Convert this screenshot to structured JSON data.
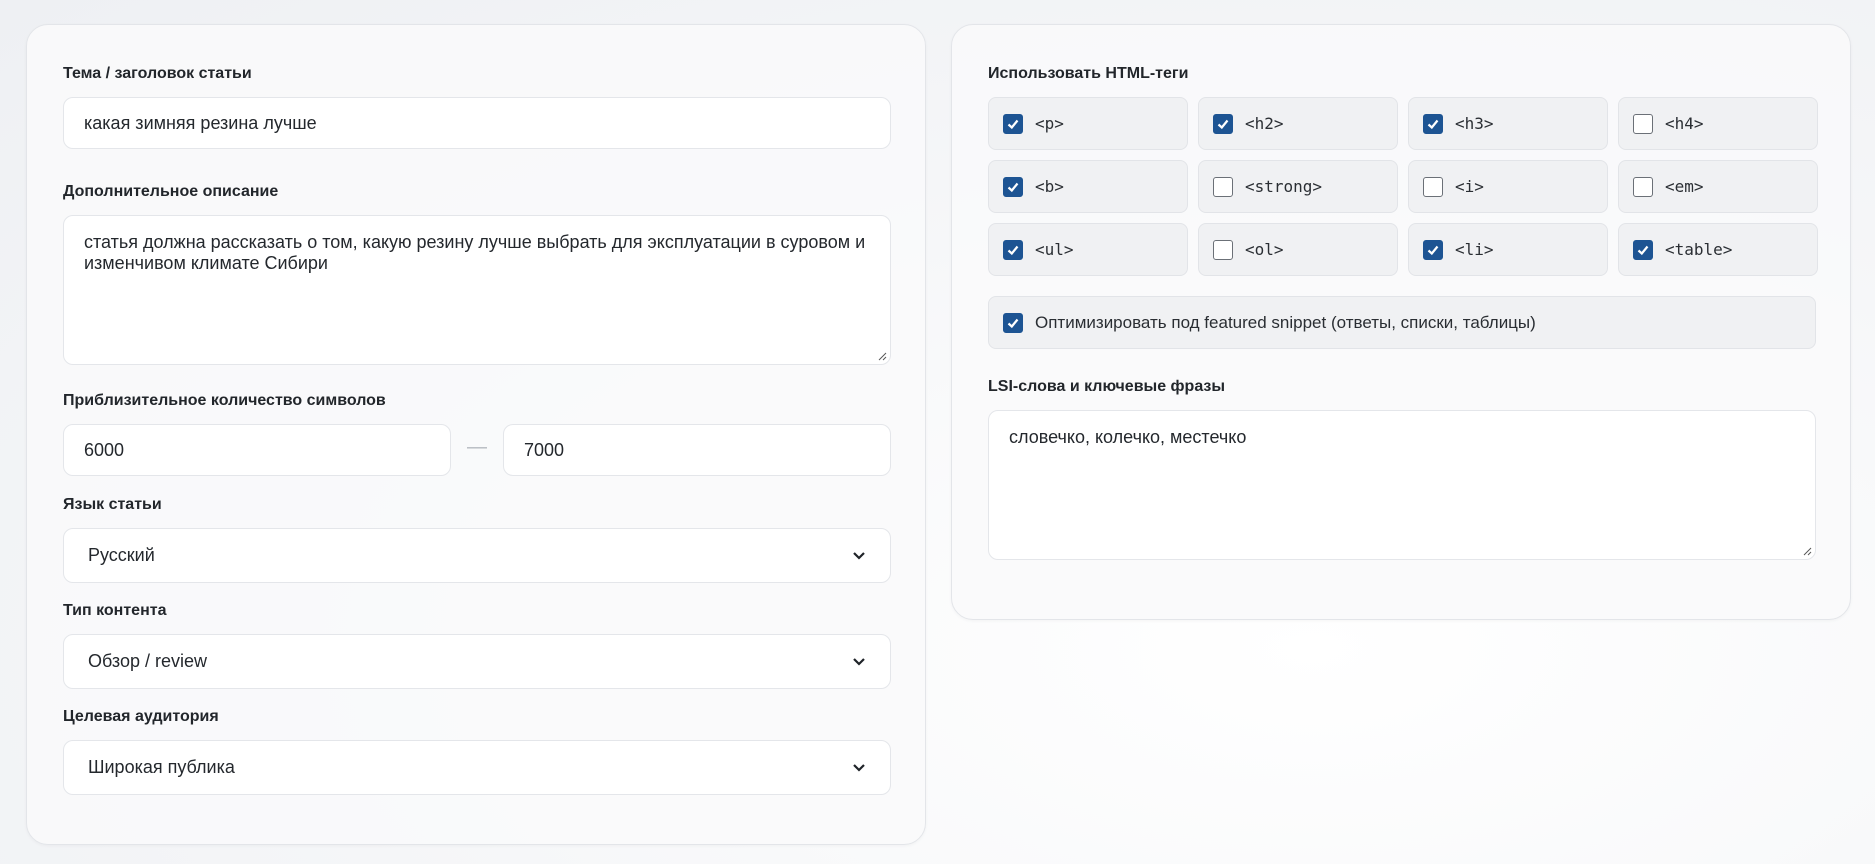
{
  "left": {
    "topic": {
      "label": "Тема / заголовок статьи",
      "value": "какая зимняя резина лучше"
    },
    "description": {
      "label": "Дополнительное описание",
      "value": "статья должна рассказать о том, какую резину лучше выбрать для эксплуатации в суровом и изменчивом климате Сибири"
    },
    "chars": {
      "label": "Приблизительное количество символов",
      "min": "6000",
      "separator": "—",
      "max": "7000"
    },
    "language": {
      "label": "Язык статьи",
      "value": "Русский"
    },
    "content_type": {
      "label": "Тип контента",
      "value": "Обзор / review"
    },
    "audience": {
      "label": "Целевая аудитория",
      "value": "Широкая публика"
    }
  },
  "right": {
    "html_tags": {
      "label": "Использовать HTML-теги",
      "items": [
        {
          "tag": "<p>",
          "checked": true
        },
        {
          "tag": "<h2>",
          "checked": true
        },
        {
          "tag": "<h3>",
          "checked": true
        },
        {
          "tag": "<h4>",
          "checked": false
        },
        {
          "tag": "<b>",
          "checked": true
        },
        {
          "tag": "<strong>",
          "checked": false
        },
        {
          "tag": "<i>",
          "checked": false
        },
        {
          "tag": "<em>",
          "checked": false
        },
        {
          "tag": "<ul>",
          "checked": true
        },
        {
          "tag": "<ol>",
          "checked": false
        },
        {
          "tag": "<li>",
          "checked": true
        },
        {
          "tag": "<table>",
          "checked": true
        }
      ]
    },
    "featured_snippet": {
      "label": "Оптимизировать под featured snippet (ответы, списки, таблицы)",
      "checked": true
    },
    "lsi": {
      "label": "LSI-слова и ключевые фразы",
      "value": "словечко, колечко, местечко"
    }
  },
  "colors": {
    "accent": "#1d5493",
    "card_border": "#e3e5e9",
    "tag_bg": "#f0f1f3"
  },
  "icons": {
    "checkbox_checked": "check-icon",
    "select_arrow": "chevron-down-icon",
    "resize": "resize-handle-icon"
  }
}
